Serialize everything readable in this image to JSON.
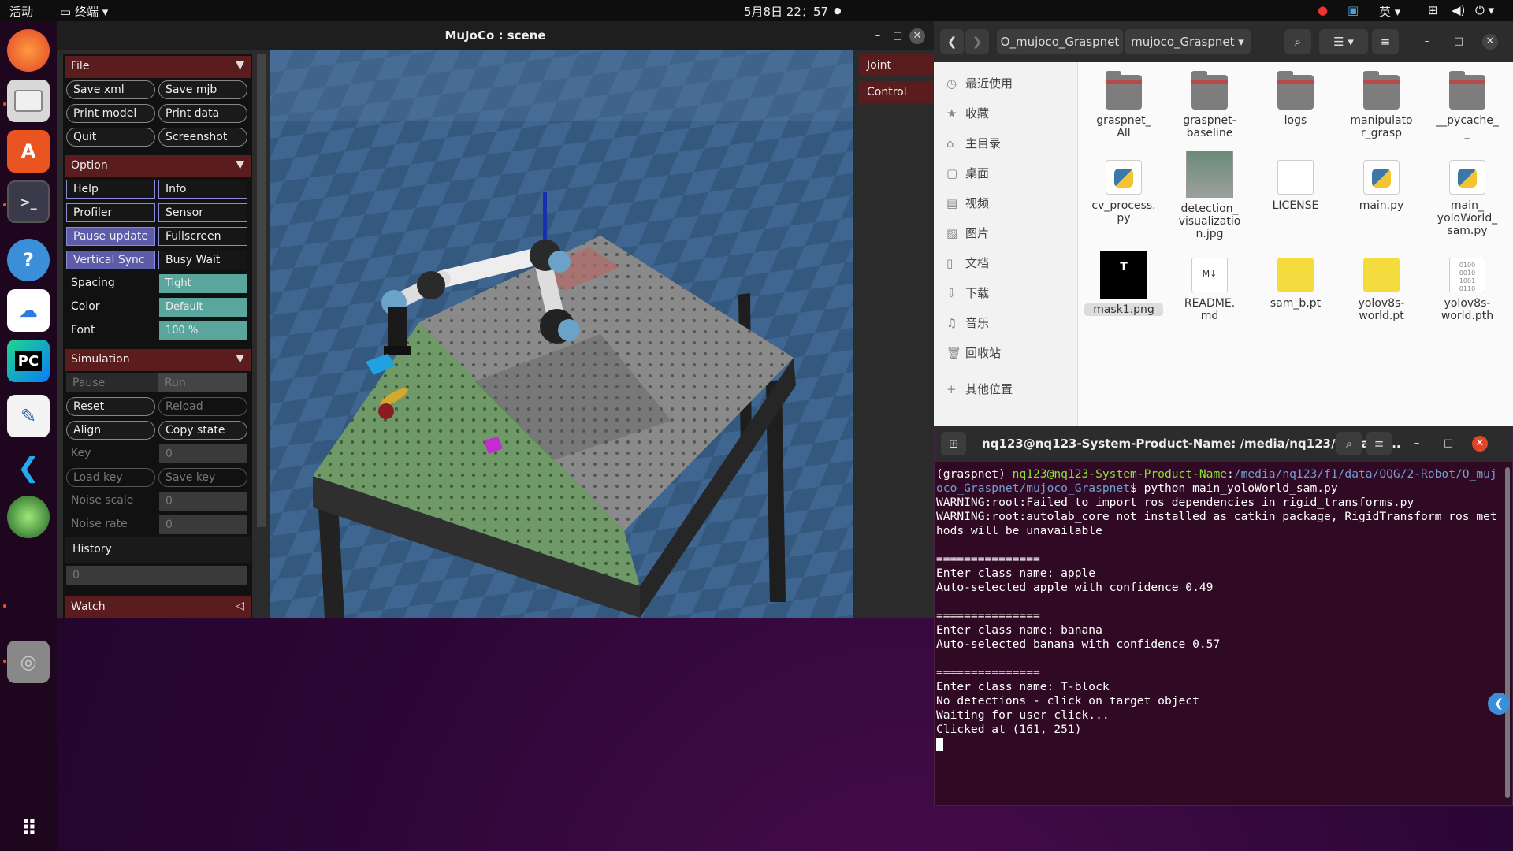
{
  "topbar": {
    "activities": "活动",
    "app": "终端",
    "datetime": "5月8日  22：57",
    "lang": "英"
  },
  "dock": {
    "items": [
      "firefox",
      "files",
      "app-center",
      "terminal",
      "help",
      "baidu-netdisk",
      "pycharm",
      "text-editor",
      "vscode",
      "chrome",
      "disc"
    ]
  },
  "mujoco": {
    "title": "MuJoCo : scene",
    "file": {
      "label": "File",
      "buttons": [
        "Save xml",
        "Save mjb",
        "Print model",
        "Print data",
        "Quit",
        "Screenshot"
      ]
    },
    "option": {
      "label": "Option",
      "toggles": [
        {
          "left": "Help",
          "right": "Info",
          "left_on": false,
          "right_on": false
        },
        {
          "left": "Profiler",
          "right": "Sensor",
          "left_on": false,
          "right_on": false
        },
        {
          "left": "Pause update",
          "right": "Fullscreen",
          "left_on": true,
          "right_on": false
        },
        {
          "left": "Vertical Sync",
          "right": "Busy Wait",
          "left_on": true,
          "right_on": false
        }
      ],
      "spacing_label": "Spacing",
      "spacing_value": "Tight",
      "color_label": "Color",
      "color_value": "Default",
      "font_label": "Font",
      "font_value": "100 %"
    },
    "simulation": {
      "label": "Simulation",
      "pause": "Pause",
      "run": "Run",
      "reset": "Reset",
      "reload": "Reload",
      "align": "Align",
      "copy_state": "Copy state",
      "key_label": "Key",
      "key_value": "0",
      "load_key": "Load key",
      "save_key": "Save key",
      "noise_scale_label": "Noise scale",
      "noise_scale_value": "0",
      "noise_rate_label": "Noise rate",
      "noise_rate_value": "0",
      "history_label": "History",
      "history_value": "0"
    },
    "watch": {
      "label": "Watch"
    },
    "right_panel": {
      "joint": "Joint",
      "control": "Control"
    }
  },
  "files": {
    "breadcrumb": [
      "O_mujoco_Graspnet",
      "mujoco_Graspnet"
    ],
    "places": [
      "最近使用",
      "收藏",
      "主目录",
      "桌面",
      "视频",
      "图片",
      "文档",
      "下载",
      "音乐",
      "回收站",
      "其他位置"
    ],
    "items": [
      {
        "name": "graspnet_\nAll",
        "type": "folder"
      },
      {
        "name": "graspnet-\nbaseline",
        "type": "folder"
      },
      {
        "name": "logs",
        "type": "folder"
      },
      {
        "name": "manipulato\nr_grasp",
        "type": "folder"
      },
      {
        "name": "__pycache_\n_",
        "type": "folder"
      },
      {
        "name": "cv_process.\npy",
        "type": "py"
      },
      {
        "name": "detection_\nvisualizatio\nn.jpg",
        "type": "image"
      },
      {
        "name": "LICENSE",
        "type": "doc"
      },
      {
        "name": "main.py",
        "type": "py"
      },
      {
        "name": "main_\nyoloWorld_\nsam.py",
        "type": "py"
      },
      {
        "name": "mask1.png",
        "type": "mask"
      },
      {
        "name": "README.\nmd",
        "type": "md"
      },
      {
        "name": "sam_b.pt",
        "type": "zip"
      },
      {
        "name": "yolov8s-\nworld.pt",
        "type": "zip"
      },
      {
        "name": "yolov8s-\nworld.pth",
        "type": "bin"
      }
    ]
  },
  "terminal": {
    "title": "nq123@nq123-System-Product-Name: /media/nq123/f1/data/...",
    "prompt_env": "(graspnet) ",
    "prompt_user": "nq123@nq123-System-Product-Name",
    "prompt_path": "/media/nq123/f1/data/OQG/2-Robot/O_mujoco_Graspnet/mujoco_Graspnet",
    "command": "$ python main_yoloWorld_sam.py",
    "output": "WARNING:root:Failed to import ros dependencies in rigid_transforms.py\nWARNING:root:autolab_core not installed as catkin package, RigidTransform ros methods will be unavailable\n\n===============\nEnter class name: apple\nAuto-selected apple with confidence 0.49\n\n===============\nEnter class name: banana\nAuto-selected banana with confidence 0.57\n\n===============\nEnter class name: T-block\nNo detections - click on target object\nWaiting for user click...\nClicked at (161, 251)"
  }
}
